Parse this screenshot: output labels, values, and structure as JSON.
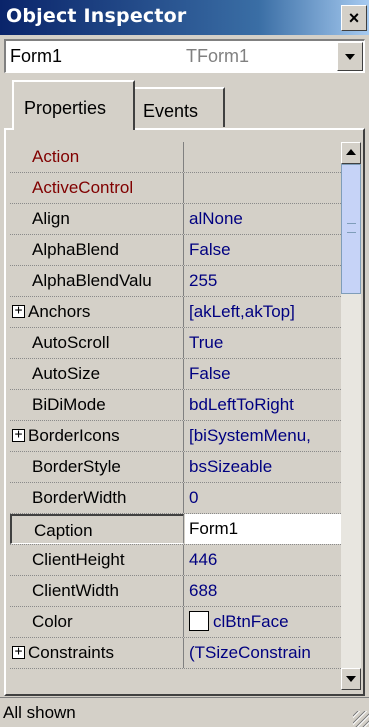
{
  "window": {
    "title": "Object Inspector",
    "close_label": "×"
  },
  "selector": {
    "object_name": "Form1",
    "object_type": "TForm1"
  },
  "tabs": [
    {
      "label": "Properties"
    },
    {
      "label": "Events"
    }
  ],
  "properties": [
    {
      "name": "Action",
      "value": "",
      "kind": "event"
    },
    {
      "name": "ActiveControl",
      "value": "",
      "kind": "event"
    },
    {
      "name": "Align",
      "value": "alNone"
    },
    {
      "name": "AlphaBlend",
      "value": "False"
    },
    {
      "name": "AlphaBlendValu",
      "value": "255"
    },
    {
      "name": "Anchors",
      "value": "[akLeft,akTop]",
      "expandable": true
    },
    {
      "name": "AutoScroll",
      "value": "True"
    },
    {
      "name": "AutoSize",
      "value": "False"
    },
    {
      "name": "BiDiMode",
      "value": "bdLeftToRight"
    },
    {
      "name": "BorderIcons",
      "value": "[biSystemMenu,",
      "expandable": true
    },
    {
      "name": "BorderStyle",
      "value": "bsSizeable"
    },
    {
      "name": "BorderWidth",
      "value": "0"
    },
    {
      "name": "Caption",
      "value": "Form1",
      "selected": true
    },
    {
      "name": "ClientHeight",
      "value": "446"
    },
    {
      "name": "ClientWidth",
      "value": "688"
    },
    {
      "name": "Color",
      "value": "clBtnFace",
      "swatch": "#ffffff"
    },
    {
      "name": "Constraints",
      "value": "(TSizeConstrain",
      "expandable": true
    }
  ],
  "expand_glyph": "+",
  "status": {
    "text": "All shown"
  }
}
